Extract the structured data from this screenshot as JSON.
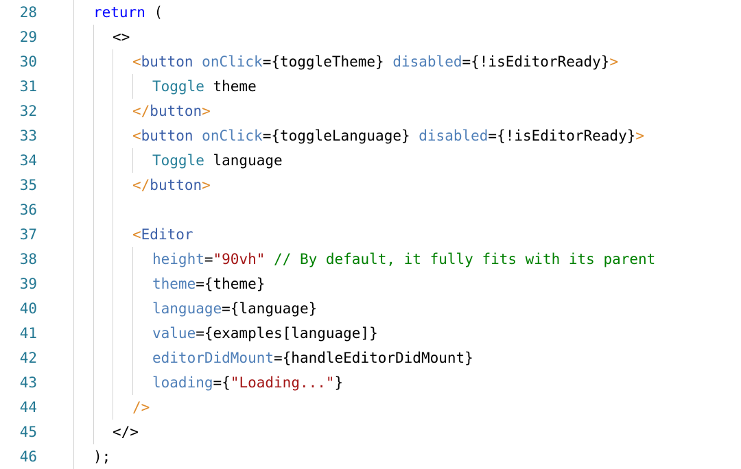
{
  "editor": {
    "colors": {
      "line_number": "#237893",
      "keyword": "#0000ff",
      "tag_bracket": "#e08c2c",
      "tag_name": "#3b5fa8",
      "attribute": "#4f7fb8",
      "identifier": "#267f99",
      "string": "#a31515",
      "comment": "#008000",
      "plain": "#000000"
    },
    "lines": [
      {
        "num": "28",
        "tokens": [
          {
            "t": "return",
            "c": "keyword"
          },
          {
            "t": " (",
            "c": "plain"
          }
        ]
      },
      {
        "num": "29",
        "tokens": [
          {
            "t": "<>",
            "c": "plain"
          }
        ]
      },
      {
        "num": "30",
        "tokens": [
          {
            "t": "<",
            "c": "tag_bracket"
          },
          {
            "t": "button",
            "c": "tag_name"
          },
          {
            "t": " ",
            "c": "plain"
          },
          {
            "t": "onClick",
            "c": "attribute"
          },
          {
            "t": "={toggleTheme} ",
            "c": "plain"
          },
          {
            "t": "disabled",
            "c": "attribute"
          },
          {
            "t": "={!isEditorReady}",
            "c": "plain"
          },
          {
            "t": ">",
            "c": "tag_bracket"
          }
        ]
      },
      {
        "num": "31",
        "tokens": [
          {
            "t": "Toggle",
            "c": "identifier"
          },
          {
            "t": " theme",
            "c": "plain"
          }
        ]
      },
      {
        "num": "32",
        "tokens": [
          {
            "t": "</",
            "c": "tag_bracket"
          },
          {
            "t": "button",
            "c": "tag_name"
          },
          {
            "t": ">",
            "c": "tag_bracket"
          }
        ]
      },
      {
        "num": "33",
        "tokens": [
          {
            "t": "<",
            "c": "tag_bracket"
          },
          {
            "t": "button",
            "c": "tag_name"
          },
          {
            "t": " ",
            "c": "plain"
          },
          {
            "t": "onClick",
            "c": "attribute"
          },
          {
            "t": "={toggleLanguage} ",
            "c": "plain"
          },
          {
            "t": "disabled",
            "c": "attribute"
          },
          {
            "t": "={!isEditorReady}",
            "c": "plain"
          },
          {
            "t": ">",
            "c": "tag_bracket"
          }
        ]
      },
      {
        "num": "34",
        "tokens": [
          {
            "t": "Toggle",
            "c": "identifier"
          },
          {
            "t": " language",
            "c": "plain"
          }
        ]
      },
      {
        "num": "35",
        "tokens": [
          {
            "t": "</",
            "c": "tag_bracket"
          },
          {
            "t": "button",
            "c": "tag_name"
          },
          {
            "t": ">",
            "c": "tag_bracket"
          }
        ]
      },
      {
        "num": "36",
        "tokens": []
      },
      {
        "num": "37",
        "tokens": [
          {
            "t": "<",
            "c": "tag_bracket"
          },
          {
            "t": "Editor",
            "c": "tag_name"
          }
        ]
      },
      {
        "num": "38",
        "tokens": [
          {
            "t": "height",
            "c": "attribute"
          },
          {
            "t": "=",
            "c": "plain"
          },
          {
            "t": "\"90vh\"",
            "c": "string"
          },
          {
            "t": " // By default, it fully fits with its parent",
            "c": "comment"
          }
        ]
      },
      {
        "num": "39",
        "tokens": [
          {
            "t": "theme",
            "c": "attribute"
          },
          {
            "t": "={theme}",
            "c": "plain"
          }
        ]
      },
      {
        "num": "40",
        "tokens": [
          {
            "t": "language",
            "c": "attribute"
          },
          {
            "t": "={language}",
            "c": "plain"
          }
        ]
      },
      {
        "num": "41",
        "tokens": [
          {
            "t": "value",
            "c": "attribute"
          },
          {
            "t": "={examples[language]}",
            "c": "plain"
          }
        ]
      },
      {
        "num": "42",
        "tokens": [
          {
            "t": "editorDidMount",
            "c": "attribute"
          },
          {
            "t": "={handleEditorDidMount}",
            "c": "plain"
          }
        ]
      },
      {
        "num": "43",
        "tokens": [
          {
            "t": "loading",
            "c": "attribute"
          },
          {
            "t": "={",
            "c": "plain"
          },
          {
            "t": "\"Loading...\"",
            "c": "string"
          },
          {
            "t": "}",
            "c": "plain"
          }
        ]
      },
      {
        "num": "44",
        "tokens": [
          {
            "t": "/>",
            "c": "tag_bracket"
          }
        ]
      },
      {
        "num": "45",
        "tokens": [
          {
            "t": "</>",
            "c": "plain"
          }
        ]
      },
      {
        "num": "46",
        "tokens": [
          {
            "t": ");",
            "c": "plain"
          }
        ]
      }
    ]
  }
}
